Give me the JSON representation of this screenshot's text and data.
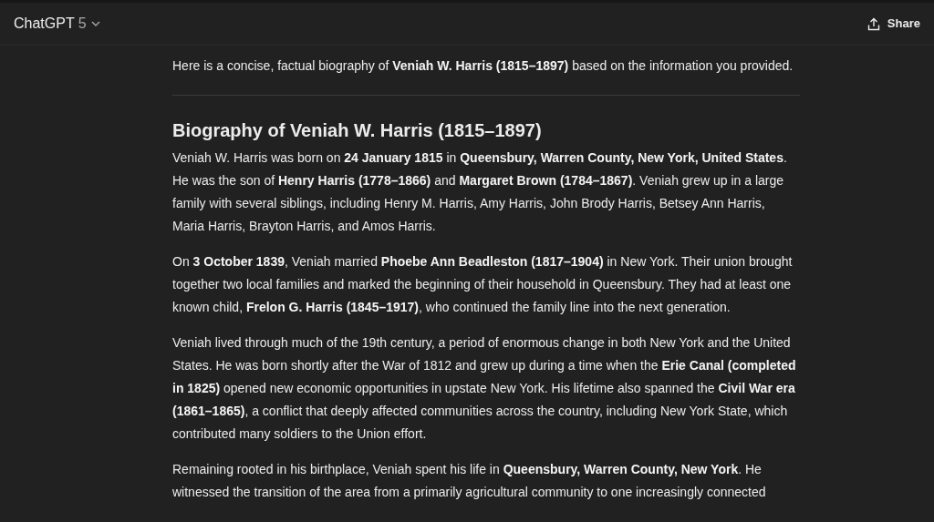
{
  "header": {
    "model_name": "ChatGPT",
    "model_version": "5",
    "share_label": "Share"
  },
  "intro": "Here is a concise, factual biography of **Veniah W. Harris (1815–1897)** based on the information you provided.",
  "heading": "Biography of Veniah W. Harris (1815–1897)",
  "paragraphs": [
    "Veniah W. Harris was born on **24 January 1815** in **Queensbury, Warren County, New York, United States**. He was the son of **Henry Harris (1778–1866)** and **Margaret Brown (1784–1867)**. Veniah grew up in a large family with several siblings, including Henry M. Harris, Amy Harris, John Brody Harris, Betsey Ann Harris, Maria Harris, Brayton Harris, and Amos Harris.",
    "On **3 October 1839**, Veniah married **Phoebe Ann Beadleston (1817–1904)** in New York. Their union brought together two local families and marked the beginning of their household in Queensbury. They had at least one known child, **Frelon G. Harris (1845–1917)**, who continued the family line into the next generation.",
    "Veniah lived through much of the 19th century, a period of enormous change in both New York and the United States. He was born shortly after the War of 1812 and grew up during a time when the **Erie Canal (completed in 1825)** opened new economic opportunities in upstate New York. His lifetime also spanned the **Civil War era (1861–1865)**, a conflict that deeply affected communities across the country, including New York State, which contributed many soldiers to the Union effort.",
    "Remaining rooted in his birthplace, Veniah spent his life in **Queensbury, Warren County, New York**. He witnessed the transition of the area from a primarily agricultural community to one increasingly connected"
  ]
}
